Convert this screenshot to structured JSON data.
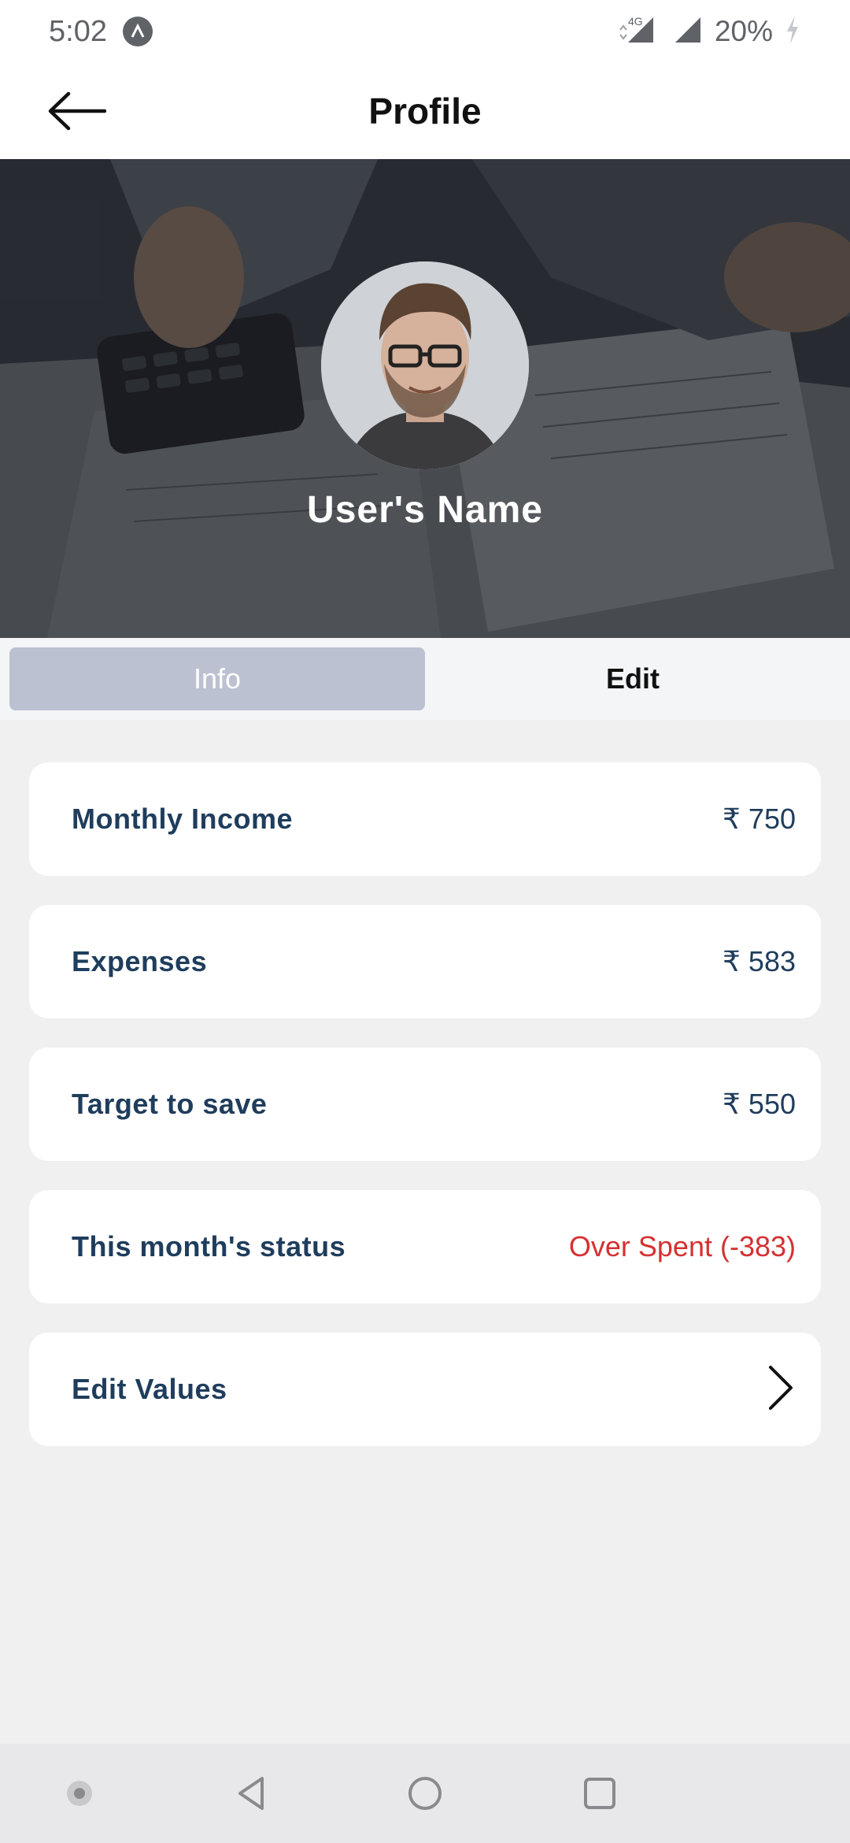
{
  "status_bar": {
    "time": "5:02",
    "network": "4G",
    "battery": "20%"
  },
  "header": {
    "title": "Profile",
    "back_icon": "arrow-left-icon"
  },
  "hero": {
    "user_name": "User's Name"
  },
  "tabs": [
    {
      "label": "Info",
      "active": true
    },
    {
      "label": "Edit",
      "active": false
    }
  ],
  "cards": [
    {
      "label": "Monthly Income",
      "value": "₹ 750"
    },
    {
      "label": "Expenses",
      "value": "₹ 583"
    },
    {
      "label": "Target to save",
      "value": "₹ 550"
    },
    {
      "label": "This month's status",
      "value": "Over Spent (-383)"
    },
    {
      "label": "Edit Values",
      "icon": "chevron-right-icon"
    }
  ],
  "colors": {
    "primary_text": "#1f3d5c",
    "danger": "#d63031",
    "tab_active_bg": "#bcc1d1",
    "background": "#f0f0f1"
  }
}
